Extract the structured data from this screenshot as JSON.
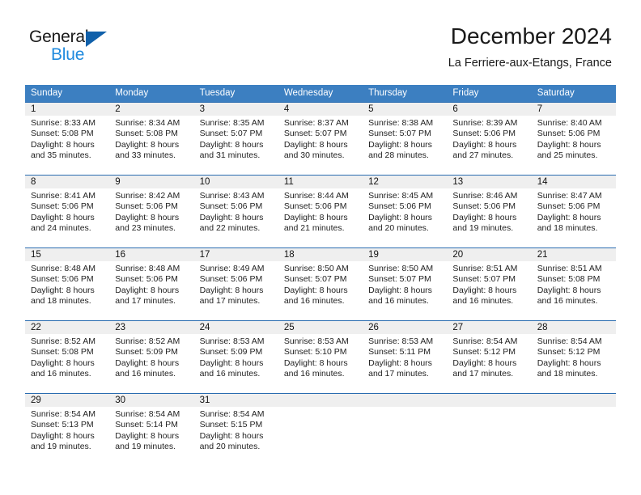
{
  "brand": {
    "name_part1": "General",
    "name_part2": "Blue",
    "logo_icon": "triangle-logo-icon"
  },
  "header": {
    "title": "December 2024",
    "location": "La Ferriere-aux-Etangs, France"
  },
  "calendar": {
    "weekdays": [
      "Sunday",
      "Monday",
      "Tuesday",
      "Wednesday",
      "Thursday",
      "Friday",
      "Saturday"
    ],
    "header_bg_color": "#3c7fc1",
    "row_border_color": "#2a6cb0",
    "day_number_bg_color": "#efefef",
    "weeks": [
      [
        {
          "day": "1",
          "sunrise": "Sunrise: 8:33 AM",
          "sunset": "Sunset: 5:08 PM",
          "daylight_line1": "Daylight: 8 hours",
          "daylight_line2": "and 35 minutes."
        },
        {
          "day": "2",
          "sunrise": "Sunrise: 8:34 AM",
          "sunset": "Sunset: 5:08 PM",
          "daylight_line1": "Daylight: 8 hours",
          "daylight_line2": "and 33 minutes."
        },
        {
          "day": "3",
          "sunrise": "Sunrise: 8:35 AM",
          "sunset": "Sunset: 5:07 PM",
          "daylight_line1": "Daylight: 8 hours",
          "daylight_line2": "and 31 minutes."
        },
        {
          "day": "4",
          "sunrise": "Sunrise: 8:37 AM",
          "sunset": "Sunset: 5:07 PM",
          "daylight_line1": "Daylight: 8 hours",
          "daylight_line2": "and 30 minutes."
        },
        {
          "day": "5",
          "sunrise": "Sunrise: 8:38 AM",
          "sunset": "Sunset: 5:07 PM",
          "daylight_line1": "Daylight: 8 hours",
          "daylight_line2": "and 28 minutes."
        },
        {
          "day": "6",
          "sunrise": "Sunrise: 8:39 AM",
          "sunset": "Sunset: 5:06 PM",
          "daylight_line1": "Daylight: 8 hours",
          "daylight_line2": "and 27 minutes."
        },
        {
          "day": "7",
          "sunrise": "Sunrise: 8:40 AM",
          "sunset": "Sunset: 5:06 PM",
          "daylight_line1": "Daylight: 8 hours",
          "daylight_line2": "and 25 minutes."
        }
      ],
      [
        {
          "day": "8",
          "sunrise": "Sunrise: 8:41 AM",
          "sunset": "Sunset: 5:06 PM",
          "daylight_line1": "Daylight: 8 hours",
          "daylight_line2": "and 24 minutes."
        },
        {
          "day": "9",
          "sunrise": "Sunrise: 8:42 AM",
          "sunset": "Sunset: 5:06 PM",
          "daylight_line1": "Daylight: 8 hours",
          "daylight_line2": "and 23 minutes."
        },
        {
          "day": "10",
          "sunrise": "Sunrise: 8:43 AM",
          "sunset": "Sunset: 5:06 PM",
          "daylight_line1": "Daylight: 8 hours",
          "daylight_line2": "and 22 minutes."
        },
        {
          "day": "11",
          "sunrise": "Sunrise: 8:44 AM",
          "sunset": "Sunset: 5:06 PM",
          "daylight_line1": "Daylight: 8 hours",
          "daylight_line2": "and 21 minutes."
        },
        {
          "day": "12",
          "sunrise": "Sunrise: 8:45 AM",
          "sunset": "Sunset: 5:06 PM",
          "daylight_line1": "Daylight: 8 hours",
          "daylight_line2": "and 20 minutes."
        },
        {
          "day": "13",
          "sunrise": "Sunrise: 8:46 AM",
          "sunset": "Sunset: 5:06 PM",
          "daylight_line1": "Daylight: 8 hours",
          "daylight_line2": "and 19 minutes."
        },
        {
          "day": "14",
          "sunrise": "Sunrise: 8:47 AM",
          "sunset": "Sunset: 5:06 PM",
          "daylight_line1": "Daylight: 8 hours",
          "daylight_line2": "and 18 minutes."
        }
      ],
      [
        {
          "day": "15",
          "sunrise": "Sunrise: 8:48 AM",
          "sunset": "Sunset: 5:06 PM",
          "daylight_line1": "Daylight: 8 hours",
          "daylight_line2": "and 18 minutes."
        },
        {
          "day": "16",
          "sunrise": "Sunrise: 8:48 AM",
          "sunset": "Sunset: 5:06 PM",
          "daylight_line1": "Daylight: 8 hours",
          "daylight_line2": "and 17 minutes."
        },
        {
          "day": "17",
          "sunrise": "Sunrise: 8:49 AM",
          "sunset": "Sunset: 5:06 PM",
          "daylight_line1": "Daylight: 8 hours",
          "daylight_line2": "and 17 minutes."
        },
        {
          "day": "18",
          "sunrise": "Sunrise: 8:50 AM",
          "sunset": "Sunset: 5:07 PM",
          "daylight_line1": "Daylight: 8 hours",
          "daylight_line2": "and 16 minutes."
        },
        {
          "day": "19",
          "sunrise": "Sunrise: 8:50 AM",
          "sunset": "Sunset: 5:07 PM",
          "daylight_line1": "Daylight: 8 hours",
          "daylight_line2": "and 16 minutes."
        },
        {
          "day": "20",
          "sunrise": "Sunrise: 8:51 AM",
          "sunset": "Sunset: 5:07 PM",
          "daylight_line1": "Daylight: 8 hours",
          "daylight_line2": "and 16 minutes."
        },
        {
          "day": "21",
          "sunrise": "Sunrise: 8:51 AM",
          "sunset": "Sunset: 5:08 PM",
          "daylight_line1": "Daylight: 8 hours",
          "daylight_line2": "and 16 minutes."
        }
      ],
      [
        {
          "day": "22",
          "sunrise": "Sunrise: 8:52 AM",
          "sunset": "Sunset: 5:08 PM",
          "daylight_line1": "Daylight: 8 hours",
          "daylight_line2": "and 16 minutes."
        },
        {
          "day": "23",
          "sunrise": "Sunrise: 8:52 AM",
          "sunset": "Sunset: 5:09 PM",
          "daylight_line1": "Daylight: 8 hours",
          "daylight_line2": "and 16 minutes."
        },
        {
          "day": "24",
          "sunrise": "Sunrise: 8:53 AM",
          "sunset": "Sunset: 5:09 PM",
          "daylight_line1": "Daylight: 8 hours",
          "daylight_line2": "and 16 minutes."
        },
        {
          "day": "25",
          "sunrise": "Sunrise: 8:53 AM",
          "sunset": "Sunset: 5:10 PM",
          "daylight_line1": "Daylight: 8 hours",
          "daylight_line2": "and 16 minutes."
        },
        {
          "day": "26",
          "sunrise": "Sunrise: 8:53 AM",
          "sunset": "Sunset: 5:11 PM",
          "daylight_line1": "Daylight: 8 hours",
          "daylight_line2": "and 17 minutes."
        },
        {
          "day": "27",
          "sunrise": "Sunrise: 8:54 AM",
          "sunset": "Sunset: 5:12 PM",
          "daylight_line1": "Daylight: 8 hours",
          "daylight_line2": "and 17 minutes."
        },
        {
          "day": "28",
          "sunrise": "Sunrise: 8:54 AM",
          "sunset": "Sunset: 5:12 PM",
          "daylight_line1": "Daylight: 8 hours",
          "daylight_line2": "and 18 minutes."
        }
      ],
      [
        {
          "day": "29",
          "sunrise": "Sunrise: 8:54 AM",
          "sunset": "Sunset: 5:13 PM",
          "daylight_line1": "Daylight: 8 hours",
          "daylight_line2": "and 19 minutes."
        },
        {
          "day": "30",
          "sunrise": "Sunrise: 8:54 AM",
          "sunset": "Sunset: 5:14 PM",
          "daylight_line1": "Daylight: 8 hours",
          "daylight_line2": "and 19 minutes."
        },
        {
          "day": "31",
          "sunrise": "Sunrise: 8:54 AM",
          "sunset": "Sunset: 5:15 PM",
          "daylight_line1": "Daylight: 8 hours",
          "daylight_line2": "and 20 minutes."
        },
        {
          "day": "",
          "sunrise": "",
          "sunset": "",
          "daylight_line1": "",
          "daylight_line2": ""
        },
        {
          "day": "",
          "sunrise": "",
          "sunset": "",
          "daylight_line1": "",
          "daylight_line2": ""
        },
        {
          "day": "",
          "sunrise": "",
          "sunset": "",
          "daylight_line1": "",
          "daylight_line2": ""
        },
        {
          "day": "",
          "sunrise": "",
          "sunset": "",
          "daylight_line1": "",
          "daylight_line2": ""
        }
      ]
    ]
  }
}
